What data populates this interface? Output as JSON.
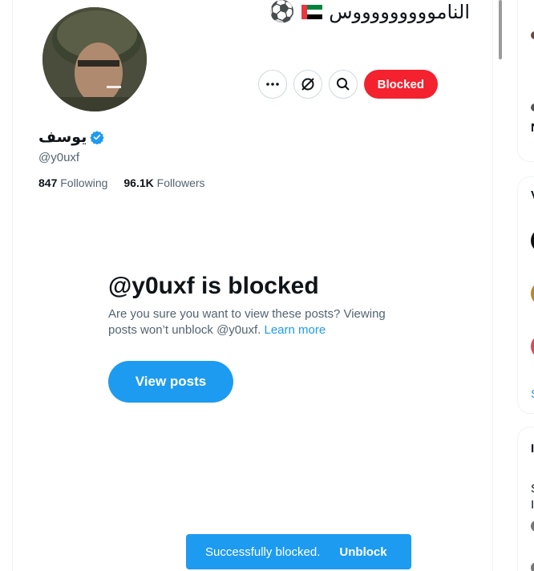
{
  "header": {
    "bio_text": "الناموووووووووس",
    "flag_emoji_name": "uae-flag",
    "ball_emoji": "⚽"
  },
  "profile": {
    "display_name": "يوسف",
    "handle": "@y0uxf",
    "following_count": "847",
    "following_label": "Following",
    "followers_count": "96.1K",
    "followers_label": "Followers",
    "verified": true
  },
  "actions": {
    "more_icon": "more-icon",
    "grok_icon": "grok-icon",
    "search_icon": "search-icon",
    "blocked_label": "Blocked"
  },
  "blocked_notice": {
    "title": "@y0uxf is blocked",
    "description": "Are you sure you want to view these posts? Viewing posts won’t unblock @y0uxf.",
    "learn_more": "Learn more",
    "view_posts_label": "View posts"
  },
  "toast": {
    "message": "Successfully blocked.",
    "action_label": "Unblock"
  },
  "sidebar": {
    "partial_glyphs": [
      "V",
      "S",
      "S",
      "I",
      "N",
      "I"
    ]
  },
  "colors": {
    "accent": "#1d9bf0",
    "blocked": "#f4212e",
    "text": "#0f1419",
    "muted": "#536471"
  }
}
